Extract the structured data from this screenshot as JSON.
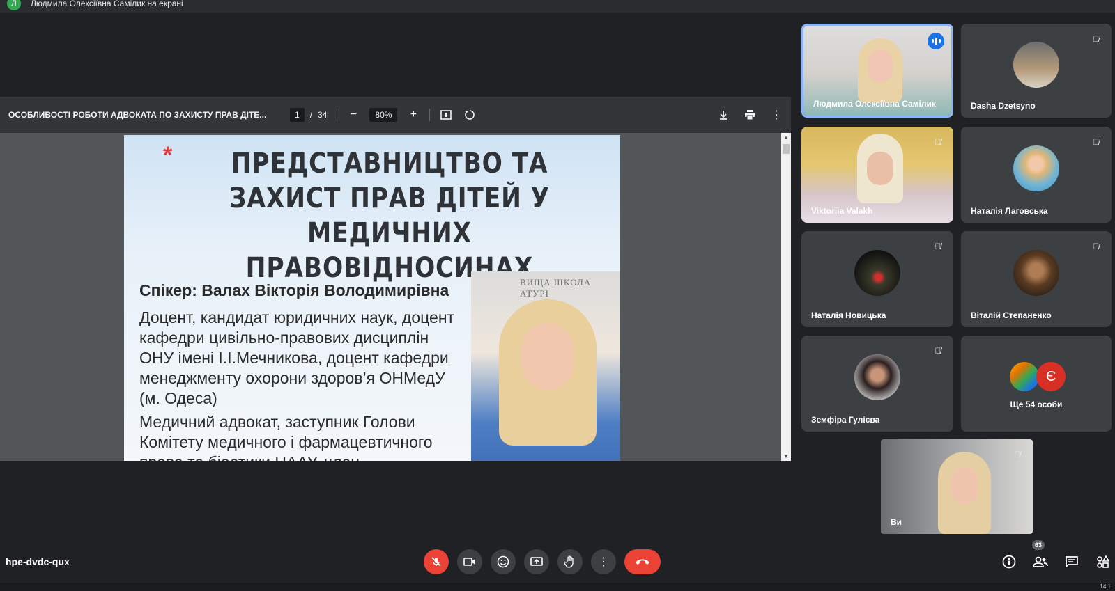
{
  "presenting_banner": {
    "avatar_letter": "Л",
    "text": "Людмила Олексіївна Самілик на екрані"
  },
  "pdf": {
    "title": "ОСОБЛИВОСТІ РОБОТИ АДВОКАТА ПО ЗАХИСТУ ПРАВ ДІТЕ...",
    "page": "1",
    "page_sep": "/",
    "total_pages": "34",
    "zoom": "80%",
    "slide": {
      "star": "*",
      "title": "ПРЕДСТАВНИЦТВО ТА ЗАХИСТ ПРАВ ДІТЕЙ У МЕДИЧНИХ ПРАВОВІДНОСИНАХ",
      "speaker": "Спікер: Валах Вікторія Володимирівна",
      "paragraph1": "Доцент, кандидат юридичних наук, доцент кафедри цивільно-правових дисциплін ОНУ імені І.І.Мечникова, доцент кафедри менеджменту охорони здоров’я ОНМедУ (м. Одеса)",
      "paragraph2": "Медичний адвокат, заступник Голови Комітету медичного і фармацевтичного права та біоетики НААУ, член",
      "photo_wall_text": "ВИЩА ШКОЛА АТУРІ"
    }
  },
  "participants": [
    {
      "name": "Людмила Олексіївна Самілик",
      "speaking": true
    },
    {
      "name": "Dasha Dzetsyno",
      "muted": true
    },
    {
      "name": "Viktoriia Valakh",
      "muted": true
    },
    {
      "name": "Наталія Лаговська",
      "muted": true
    },
    {
      "name": "Наталія Новицька",
      "muted": true
    },
    {
      "name": "Віталій Степаненко",
      "muted": true
    },
    {
      "name": "Земфіра Гулієва",
      "muted": true
    }
  ],
  "more": {
    "avatar_letter": "Є",
    "label": "Ще 54 особи"
  },
  "self_tile": {
    "name": "Ви"
  },
  "meeting_code": "hpe-dvdc-qux",
  "people_count": "63",
  "clock": "14:1"
}
